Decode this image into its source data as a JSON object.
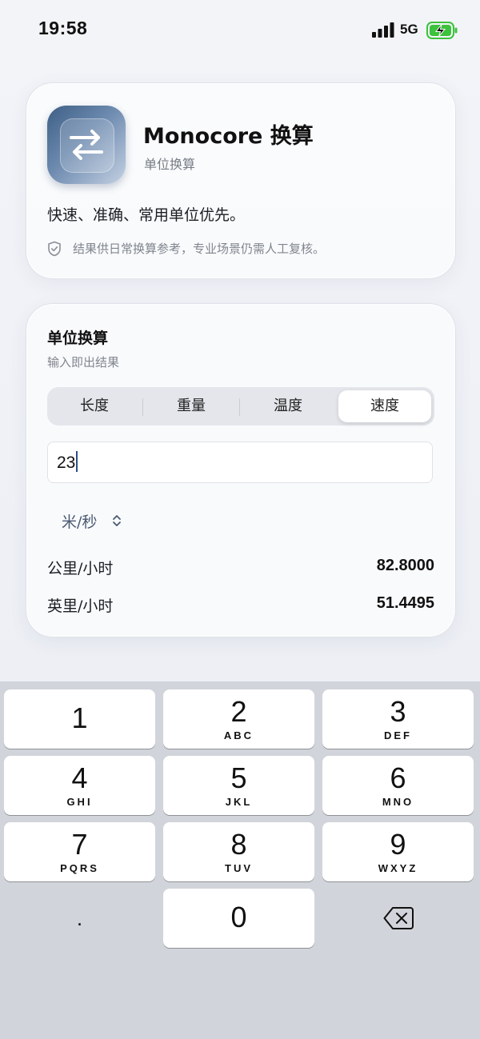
{
  "status_bar": {
    "time": "19:58",
    "network": "5G"
  },
  "header": {
    "app_name": "Monocore 换算",
    "app_subtitle": "单位换算",
    "tagline": "快速、准确、常用单位优先。",
    "disclaimer": "结果供日常换算参考，专业场景仍需人工复核。"
  },
  "converter": {
    "title": "单位换算",
    "subtitle": "输入即出结果",
    "tabs": [
      {
        "label": "长度"
      },
      {
        "label": "重量"
      },
      {
        "label": "温度"
      },
      {
        "label": "速度"
      }
    ],
    "active_tab": "速度",
    "input_value": "23",
    "from_unit": "米/秒",
    "results": [
      {
        "unit": "公里/小时",
        "value": "82.8000"
      },
      {
        "unit": "英里/小时",
        "value": "51.4495"
      }
    ]
  },
  "keyboard": {
    "keys": [
      {
        "digit": "1",
        "letters": ""
      },
      {
        "digit": "2",
        "letters": "ABC"
      },
      {
        "digit": "3",
        "letters": "DEF"
      },
      {
        "digit": "4",
        "letters": "GHI"
      },
      {
        "digit": "5",
        "letters": "JKL"
      },
      {
        "digit": "6",
        "letters": "MNO"
      },
      {
        "digit": "7",
        "letters": "PQRS"
      },
      {
        "digit": "8",
        "letters": "TUV"
      },
      {
        "digit": "9",
        "letters": "WXYZ"
      },
      {
        "digit": "0",
        "letters": ""
      }
    ],
    "decimal_key": "."
  },
  "colors": {
    "accent": "#2c4d86",
    "unit_text": "#4a5a73",
    "muted_text": "#80858e",
    "keyboard_bg": "#d1d4da"
  },
  "icons": {
    "app_icon": "swap-arrows-icon",
    "disclaimer_icon": "shield-check-icon",
    "unit_picker": "chevron-up-down-icon",
    "delete_key": "backspace-icon"
  }
}
